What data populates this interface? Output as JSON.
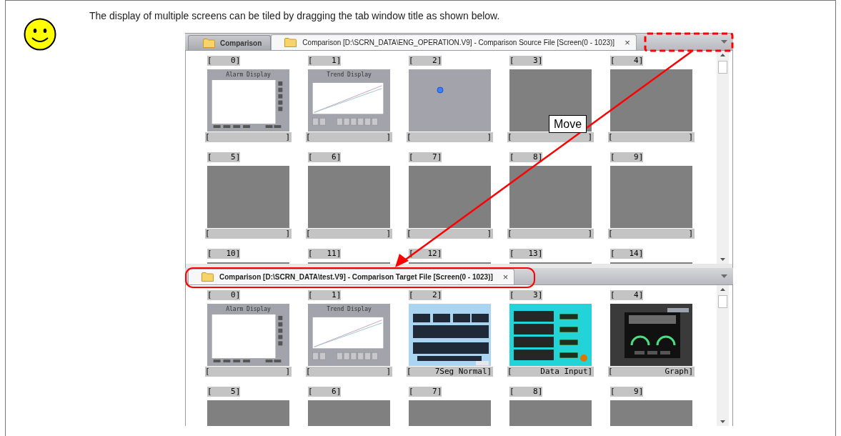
{
  "intro": {
    "text": "The display of multiple screens can be tiled by dragging the tab window title as shown below."
  },
  "panes": [
    {
      "active": false,
      "menu": true,
      "tabs": [
        {
          "label": "Comparison",
          "selected": false
        },
        {
          "label": "Comparison [D:\\SCRN_DATA\\ENG_OPERATION.V9] - Comparison Source File [Screen(0 - 1023)]",
          "selected": true,
          "close": "×"
        }
      ],
      "screens": [
        {
          "label": "[    0]",
          "kind": "alarm",
          "title": "Alarm Display",
          "name": "[                ]"
        },
        {
          "label": "[    1]",
          "kind": "trend",
          "title": "Trend Display",
          "name": "[                ]"
        },
        {
          "label": "[    2]",
          "kind": "marker",
          "name": "[                ]"
        },
        {
          "label": "[    3]",
          "kind": "empty",
          "name": "[                ]"
        },
        {
          "label": "[    4]",
          "kind": "empty",
          "name": "[                ]"
        },
        {
          "label": "[    5]",
          "kind": "empty",
          "name": "[                ]"
        },
        {
          "label": "[    6]",
          "kind": "empty",
          "name": "[                ]"
        },
        {
          "label": "[    7]",
          "kind": "empty",
          "name": "[                ]"
        },
        {
          "label": "[    8]",
          "kind": "empty",
          "name": "[                ]"
        },
        {
          "label": "[    9]",
          "kind": "empty",
          "name": "[                ]"
        },
        {
          "label": "[   10]",
          "kind": "empty"
        },
        {
          "label": "[   11]",
          "kind": "empty"
        },
        {
          "label": "[   12]",
          "kind": "empty"
        },
        {
          "label": "[   13]",
          "kind": "empty"
        },
        {
          "label": "[   14]",
          "kind": "empty"
        }
      ]
    },
    {
      "active": true,
      "menu": true,
      "tabs": [
        {
          "label": "Comparison [D:\\SCRN_DATA\\test.V9] - Comparison Target File [Screen(0 - 1023)]",
          "selected": true,
          "close": "×"
        }
      ],
      "screens": [
        {
          "label": "[    0]",
          "kind": "alarm",
          "title": "Alarm Display",
          "name": "[                ]"
        },
        {
          "label": "[    1]",
          "kind": "trend",
          "title": "Trend Display",
          "name": "[                ]"
        },
        {
          "label": "[    2]",
          "kind": "table",
          "name": "[     7Seg Normal]"
        },
        {
          "label": "[    3]",
          "kind": "input",
          "name": "[      Data Input]"
        },
        {
          "label": "[    4]",
          "kind": "gauge",
          "name": "[           Graph]"
        },
        {
          "label": "[    5]",
          "kind": "empty"
        },
        {
          "label": "[    6]",
          "kind": "empty"
        },
        {
          "label": "[    7]",
          "kind": "empty"
        },
        {
          "label": "[    8]",
          "kind": "empty"
        },
        {
          "label": "[    9]",
          "kind": "empty"
        }
      ]
    }
  ],
  "annotation": {
    "label": "Move"
  }
}
